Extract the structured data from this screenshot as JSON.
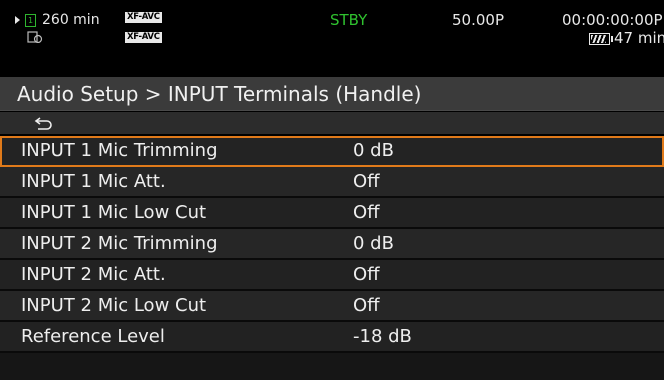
{
  "status": {
    "remaining_time": "260 min",
    "slot_number": "1",
    "codec_badge_1": "XF-AVC",
    "codec_badge_2": "XF-AVC",
    "mode": "STBY",
    "frame_rate": "50.00P",
    "timecode": "00:00:00:00",
    "timecode_suffix": "P",
    "battery_time": "47 min",
    "colors": {
      "stby": "#2fc22f",
      "slot": "#2fb52f"
    }
  },
  "menu": {
    "breadcrumb": "Audio Setup > INPUT Terminals (Handle)",
    "back_icon": "back-return-icon",
    "items": [
      {
        "label": "INPUT 1 Mic Trimming",
        "value": "0 dB",
        "selected": true
      },
      {
        "label": "INPUT 1 Mic Att.",
        "value": "Off"
      },
      {
        "label": "INPUT 1 Mic Low Cut",
        "value": "Off"
      },
      {
        "label": "INPUT 2 Mic Trimming",
        "value": "0 dB"
      },
      {
        "label": "INPUT 2 Mic Att.",
        "value": "Off"
      },
      {
        "label": "INPUT 2 Mic Low Cut",
        "value": "Off"
      },
      {
        "label": "Reference Level",
        "value": "-18 dB"
      }
    ],
    "selection_color": "#e07a1a"
  }
}
